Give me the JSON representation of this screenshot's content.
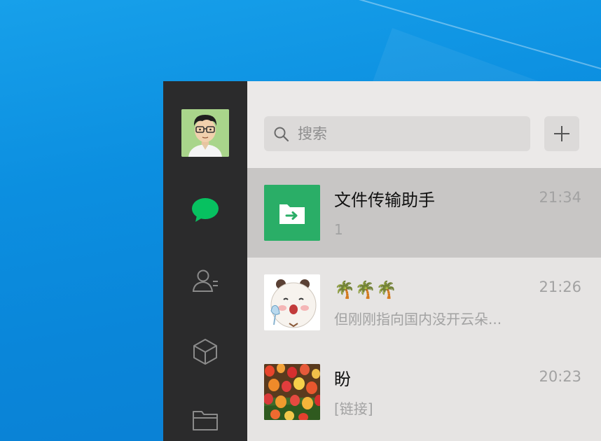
{
  "sidebar": {
    "avatar_icon": "user-avatar-cartoon-glasses",
    "nav": [
      {
        "name": "chats",
        "icon": "chat-bubble-icon",
        "active": true,
        "color": "#07c160"
      },
      {
        "name": "contacts",
        "icon": "contacts-icon",
        "active": false
      },
      {
        "name": "favorites",
        "icon": "cube-icon",
        "active": false
      },
      {
        "name": "files",
        "icon": "folder-icon",
        "active": false
      }
    ]
  },
  "search": {
    "placeholder": "搜索"
  },
  "chats": [
    {
      "name": "文件传输助手",
      "time": "21:34",
      "preview": "1",
      "avatar_icon": "file-transfer-icon",
      "avatar_color": "#2aae67",
      "selected": true
    },
    {
      "name": "🌴🌴🌴",
      "time": "21:26",
      "preview": "但刚刚指向国内没开云朵...",
      "avatar_icon": "panda-bear-sticker",
      "selected": false
    },
    {
      "name": "盼",
      "time": "20:23",
      "preview": "[链接]",
      "avatar_icon": "tulip-photo",
      "selected": false
    }
  ],
  "colors": {
    "sidebar": "#2b2b2c",
    "panel": "#e6e4e3",
    "selected": "#c8c6c5",
    "accent": "#07c160"
  }
}
